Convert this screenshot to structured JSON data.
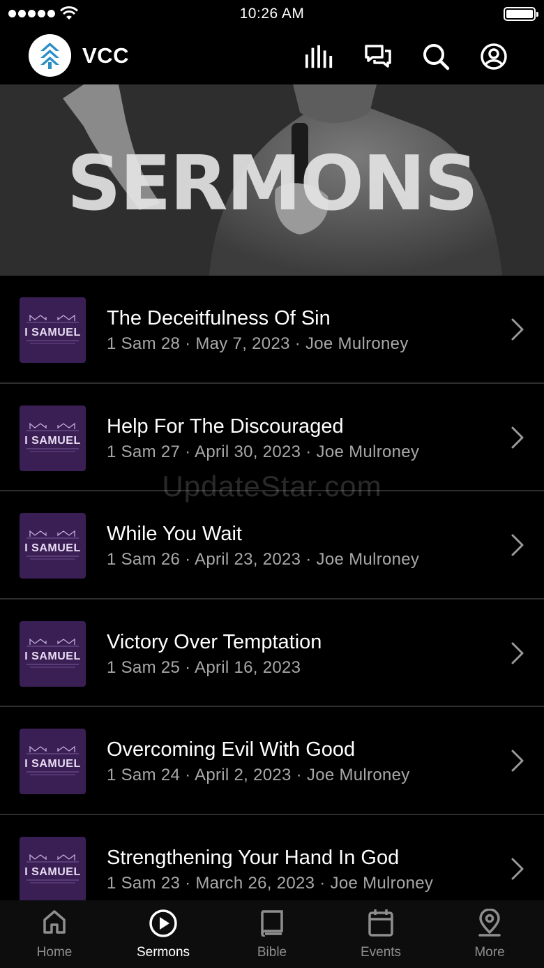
{
  "status_bar": {
    "time": "10:26 AM"
  },
  "header": {
    "brand": "VCC",
    "icons": [
      "bars-icon",
      "chat-icon",
      "search-icon",
      "account-icon"
    ]
  },
  "hero": {
    "title": "SERMONS"
  },
  "watermark": "UpdateStar.com",
  "sermons": [
    {
      "title": "The Deceitfulness Of Sin",
      "meta": "1 Sam 28 · May 7, 2023 · Joe Mulroney",
      "thumb": "I SAMUEL"
    },
    {
      "title": "Help For The Discouraged",
      "meta": "1 Sam 27 · April 30, 2023 · Joe Mulroney",
      "thumb": "I SAMUEL"
    },
    {
      "title": "While You Wait",
      "meta": "1 Sam 26 · April 23, 2023 · Joe Mulroney",
      "thumb": "I SAMUEL"
    },
    {
      "title": "Victory Over Temptation",
      "meta": "1 Sam 25 · April 16, 2023",
      "thumb": "I SAMUEL"
    },
    {
      "title": "Overcoming Evil With Good",
      "meta": "1 Sam 24 · April 2, 2023 · Joe Mulroney",
      "thumb": "I SAMUEL"
    },
    {
      "title": "Strengthening Your Hand In God",
      "meta": "1 Sam 23 · March 26, 2023 · Joe Mulroney",
      "thumb": "I SAMUEL"
    }
  ],
  "tabs": [
    {
      "label": "Home",
      "icon": "home-icon"
    },
    {
      "label": "Sermons",
      "icon": "play-circle-icon",
      "active": true
    },
    {
      "label": "Bible",
      "icon": "book-icon"
    },
    {
      "label": "Events",
      "icon": "calendar-icon"
    },
    {
      "label": "More",
      "icon": "location-pin-icon"
    }
  ],
  "colors": {
    "background": "#000000",
    "thumb_purple": "#3a1f55",
    "logo_blue": "#2a8fc7",
    "muted_text": "#a8a8a8"
  }
}
